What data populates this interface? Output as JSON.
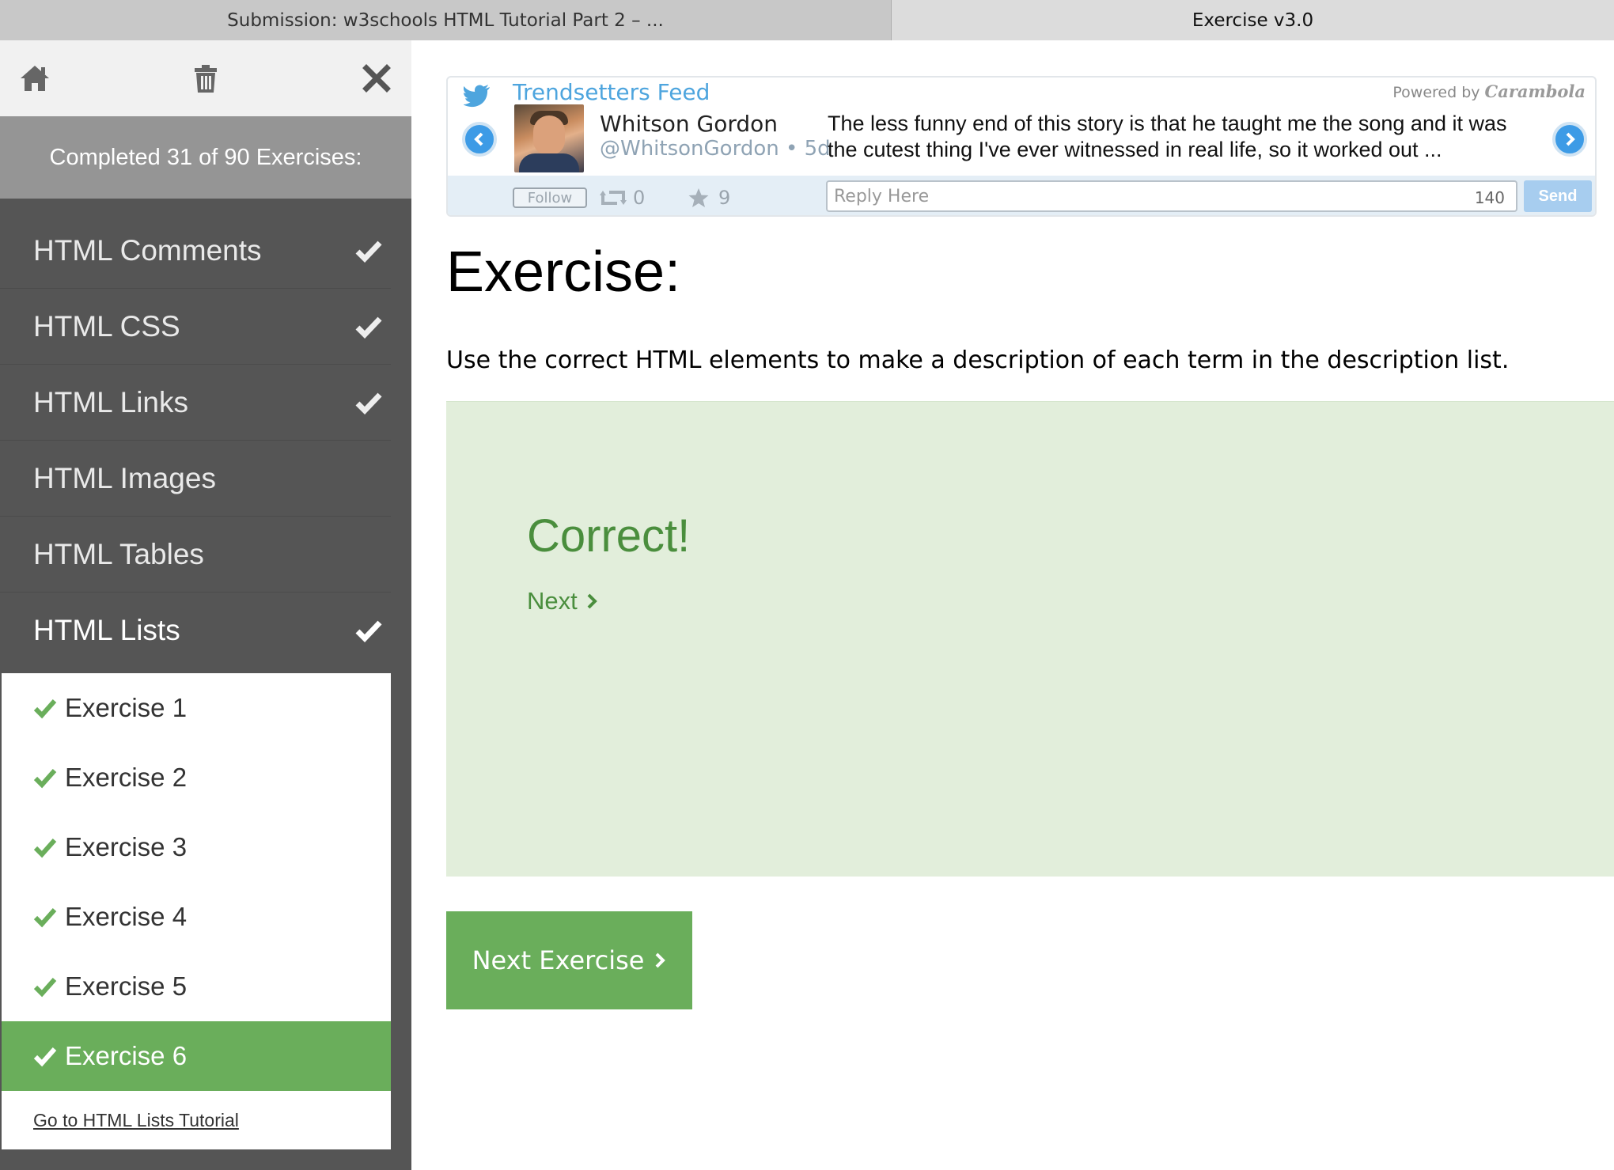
{
  "browser": {
    "tabs": [
      {
        "label": "Submission: w3schools HTML Tutorial Part 2 – ..."
      },
      {
        "label": "Exercise v3.0"
      }
    ]
  },
  "sidebar": {
    "toolbar": {
      "home_icon": "home-icon",
      "trash_icon": "trash-icon",
      "close_icon": "close-icon"
    },
    "progress_text": "Completed 31 of 90 Exercises:",
    "nav_items": [
      {
        "label": "HTML Comments",
        "completed": true
      },
      {
        "label": "HTML CSS",
        "completed": true
      },
      {
        "label": "HTML Links",
        "completed": true
      },
      {
        "label": "HTML Images",
        "completed": false
      },
      {
        "label": "HTML Tables",
        "completed": false
      },
      {
        "label": "HTML Lists",
        "completed": true,
        "active": true
      }
    ],
    "exercises": [
      {
        "label": "Exercise 1",
        "completed": true
      },
      {
        "label": "Exercise 2",
        "completed": true
      },
      {
        "label": "Exercise 3",
        "completed": true
      },
      {
        "label": "Exercise 4",
        "completed": true
      },
      {
        "label": "Exercise 5",
        "completed": true
      },
      {
        "label": "Exercise 6",
        "completed": true,
        "active": true
      }
    ],
    "tutorial_link": "Go to HTML Lists Tutorial"
  },
  "widget": {
    "feed_title": "Trendsetters Feed",
    "powered_by": "Powered by",
    "powered_brand": "Carambola",
    "author_name": "Whitson Gordon",
    "author_handle": "@WhitsonGordon • 5d",
    "tweet_text": "The less funny end of this story is that he taught me the song and it was the cutest thing I've ever witnessed in real life, so it worked out ...",
    "follow_label": "Follow",
    "retweets": "0",
    "favorites": "9",
    "reply_placeholder": "Reply Here",
    "char_count": "140",
    "send_label": "Send"
  },
  "main": {
    "heading": "Exercise:",
    "description": "Use the correct HTML elements to make a description of each term in the description list.",
    "result_title": "Correct!",
    "next_label": "Next",
    "next_exercise_label": "Next Exercise"
  },
  "colors": {
    "sidebar_bg": "#555555",
    "banner_bg": "#959595",
    "accent_green": "#6aae5b",
    "result_bg": "#e2eedb",
    "result_text": "#4a8e3d",
    "twitter_blue": "#4ea5de"
  }
}
